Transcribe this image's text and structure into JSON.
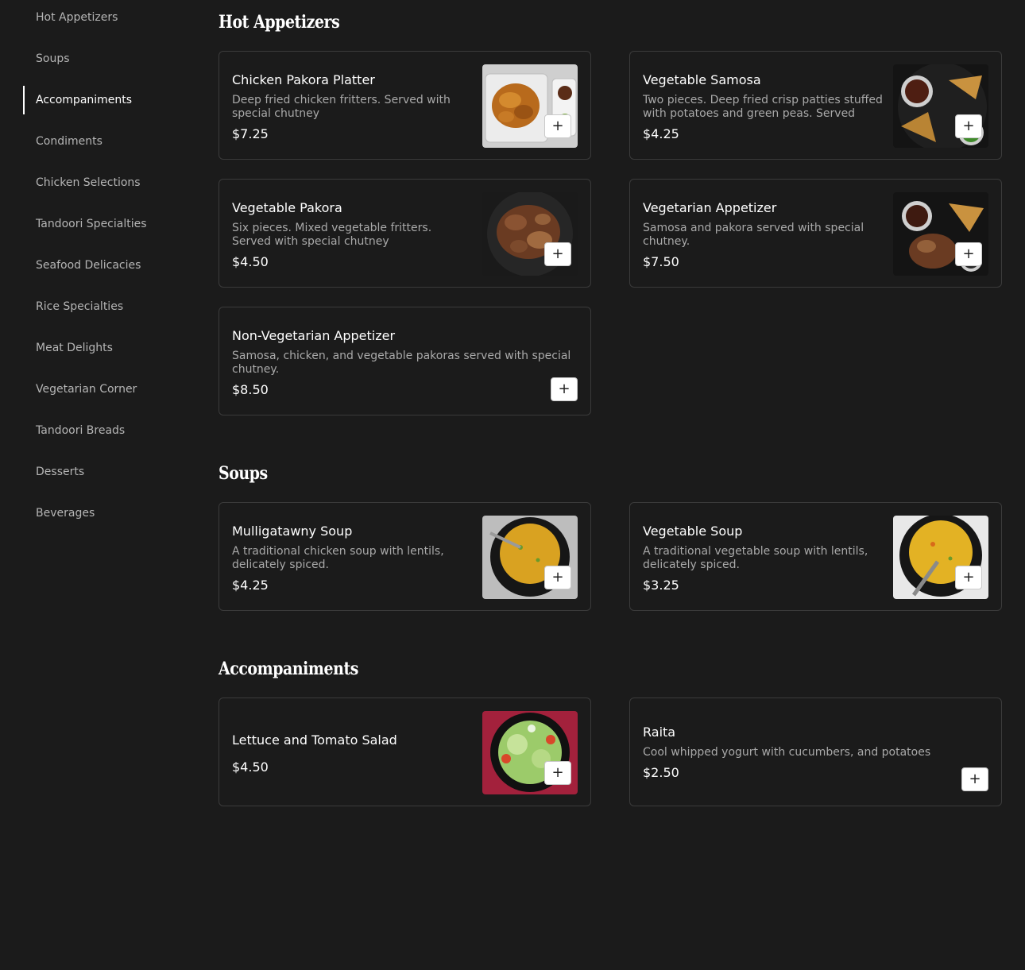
{
  "sidebar": {
    "items": [
      {
        "label": "Hot Appetizers"
      },
      {
        "label": "Soups"
      },
      {
        "label": "Accompaniments"
      },
      {
        "label": "Condiments"
      },
      {
        "label": "Chicken Selections"
      },
      {
        "label": "Tandoori Specialties"
      },
      {
        "label": "Seafood Delicacies"
      },
      {
        "label": "Rice Specialties"
      },
      {
        "label": "Meat Delights"
      },
      {
        "label": "Vegetarian Corner"
      },
      {
        "label": "Tandoori Breads"
      },
      {
        "label": "Desserts"
      },
      {
        "label": "Beverages"
      }
    ],
    "active": "Accompaniments"
  },
  "sections": [
    {
      "title": "Hot Appetizers",
      "items": [
        {
          "name": "Chicken Pakora Platter",
          "desc": "Deep fried chicken fritters. Served with special chutney",
          "price": "$7.25"
        },
        {
          "name": "Vegetable Samosa",
          "desc": "Two pieces. Deep fried crisp patties stuffed with potatoes and green peas. Served wit...",
          "price": "$4.25"
        },
        {
          "name": "Vegetable Pakora",
          "desc": "Six pieces. Mixed vegetable fritters. Served with special chutney",
          "price": "$4.50"
        },
        {
          "name": "Vegetarian Appetizer",
          "desc": "Samosa and pakora served with special chutney.",
          "price": "$7.50"
        },
        {
          "name": "Non-Vegetarian Appetizer",
          "desc": "Samosa, chicken, and vegetable pakoras served with special chutney.",
          "price": "$8.50"
        }
      ]
    },
    {
      "title": "Soups",
      "items": [
        {
          "name": "Mulligatawny Soup",
          "desc": "A traditional chicken soup with lentils, delicately spiced.",
          "price": "$4.25"
        },
        {
          "name": "Vegetable Soup",
          "desc": "A traditional vegetable soup with lentils, delicately spiced.",
          "price": "$3.25"
        }
      ]
    },
    {
      "title": "Accompaniments",
      "items": [
        {
          "name": "Lettuce and Tomato Salad",
          "price": "$4.50"
        },
        {
          "name": "Raita",
          "desc": "Cool whipped yogurt with cucumbers, and potatoes",
          "price": "$2.50"
        }
      ]
    }
  ],
  "add_label": "+",
  "colors": {
    "background": "#1b1b1b",
    "card_border": "#3b3b3b",
    "muted_text": "#a9a9a9",
    "button": "#ffffff"
  }
}
